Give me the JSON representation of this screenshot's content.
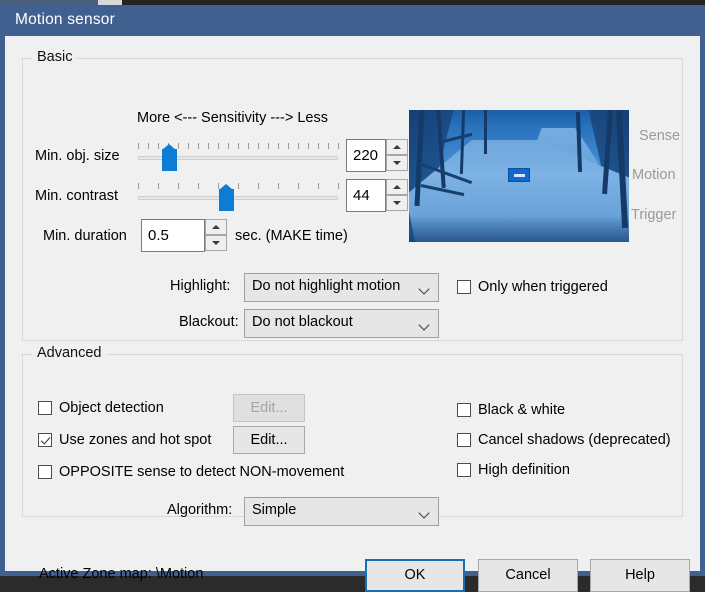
{
  "window": {
    "title": "Motion sensor",
    "accent": "#40618f",
    "client_bg": "#f0f0f0"
  },
  "basic": {
    "legend": "Basic",
    "sensitivity_header": "More <--- Sensitivity ---> Less",
    "min_obj_size": {
      "label": "Min. obj. size",
      "value": "220",
      "slider_percent": 13,
      "tick_count": 21
    },
    "min_contrast": {
      "label": "Min. contrast",
      "value": "44",
      "slider_percent": 44,
      "tick_count": 11
    },
    "min_duration": {
      "label": "Min. duration",
      "value": "0.5",
      "unit": "sec.  (MAKE time)"
    },
    "highlight": {
      "label": "Highlight:",
      "value": "Do not highlight motion"
    },
    "blackout": {
      "label": "Blackout:",
      "value": "Do not blackout"
    },
    "only_when_triggered": {
      "label": "Only when triggered",
      "checked": false
    },
    "preview": {
      "indicators": [
        "Sense",
        "Motion",
        "Trigger"
      ],
      "indicator_color": "#9a9a9a",
      "marker_color": "#1168cf"
    }
  },
  "advanced": {
    "legend": "Advanced",
    "object_detection": {
      "label": "Object detection",
      "checked": false,
      "edit_label": "Edit...",
      "edit_enabled": false
    },
    "use_zones": {
      "label": "Use zones and hot spot",
      "checked": true,
      "edit_label": "Edit...",
      "edit_enabled": true
    },
    "opposite_sense": {
      "label": "OPPOSITE sense to detect NON-movement",
      "checked": false
    },
    "black_and_white": {
      "label": "Black & white",
      "checked": false
    },
    "cancel_shadows": {
      "label": "Cancel shadows (deprecated)",
      "checked": false
    },
    "high_definition": {
      "label": "High definition",
      "checked": false
    },
    "algorithm": {
      "label": "Algorithm:",
      "value": "Simple"
    }
  },
  "footer": {
    "active_zone_map": "Active Zone map:  \\Motion",
    "ok": "OK",
    "cancel": "Cancel",
    "help": "Help"
  }
}
